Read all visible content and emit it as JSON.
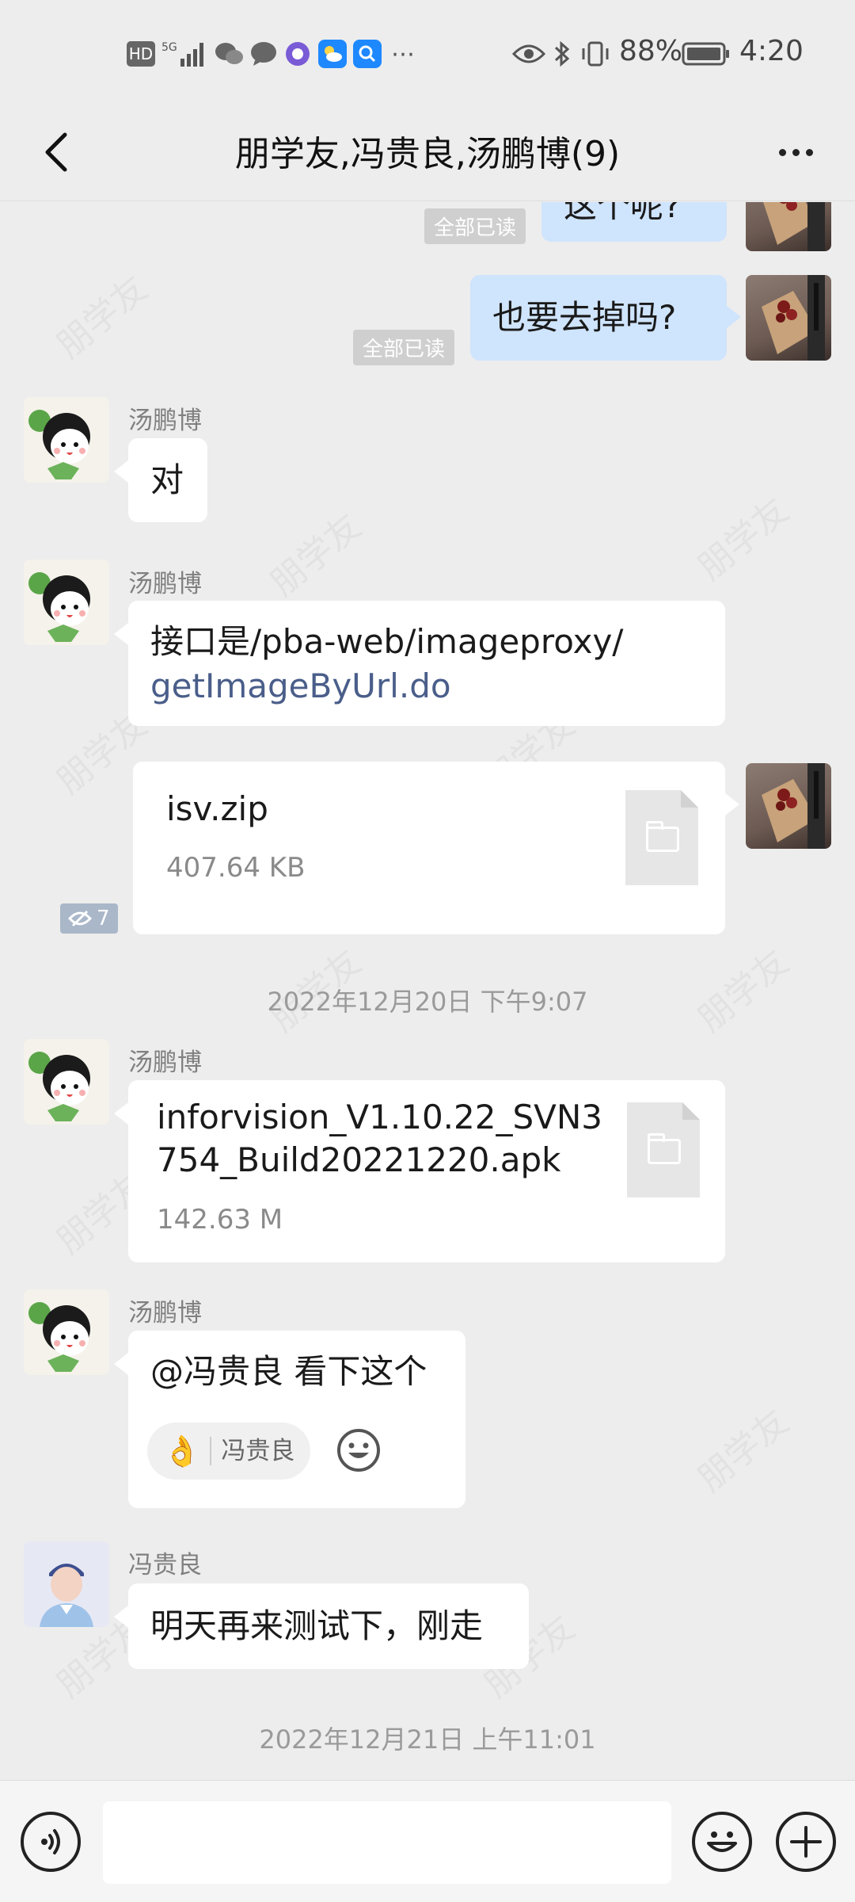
{
  "status_bar": {
    "hd": "HD",
    "network": "5G",
    "battery": "88%",
    "time": "4:20"
  },
  "header": {
    "title": "朋学友,冯贵良,汤鹏博(9)"
  },
  "messages": {
    "m1": {
      "text": "这个呢?",
      "read_status": "全部已读"
    },
    "m2": {
      "text": "也要去掉吗?",
      "read_status": "全部已读"
    },
    "m3": {
      "sender": "汤鹏博",
      "text": "对"
    },
    "m4": {
      "sender": "汤鹏博",
      "text_plain": "接口是/pba-web/imageproxy/",
      "text_link": "getImageByUrl.do"
    },
    "m5": {
      "file_name": "isv.zip",
      "file_size": "407.64 KB",
      "view_count": "7"
    },
    "time1": "2022年12月20日 下午9:07",
    "m6": {
      "sender": "汤鹏博",
      "file_name_line1": "inforvision_V1.10.22_SVN3",
      "file_name_line2": "754_Build20221220.apk",
      "file_size": "142.63 M"
    },
    "m7": {
      "sender": "汤鹏博",
      "text": "@冯贵良 看下这个",
      "reaction_emoji": "👌",
      "reaction_user": "冯贵良"
    },
    "m8": {
      "sender": "冯贵良",
      "text": "明天再来测试下，刚走"
    },
    "time2": "2022年12月21日 上午11:01"
  },
  "input_bar": {
    "placeholder": ""
  },
  "watermark": "朋学友",
  "colors": {
    "background": "#ededed",
    "self_bubble": "#cfe4fd",
    "other_bubble": "#ffffff",
    "link": "#4a5e8a"
  }
}
